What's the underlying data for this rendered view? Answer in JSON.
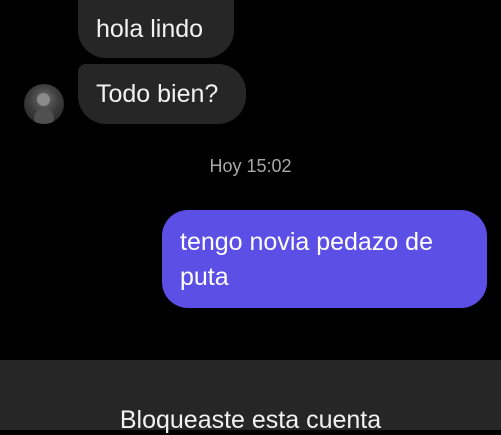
{
  "chat": {
    "incoming_messages": [
      "hola lindo",
      "Todo bien?"
    ],
    "timestamp": "Hoy 15:02",
    "outgoing_message": "tengo novia pedazo de puta"
  },
  "footer": {
    "blocked_text": "Bloqueaste esta cuenta"
  },
  "colors": {
    "background": "#000000",
    "incoming_bubble": "#262626",
    "outgoing_bubble": "#5b4fe6",
    "timestamp_text": "#a8a8a8"
  },
  "icons": {
    "avatar": "contact-avatar"
  }
}
